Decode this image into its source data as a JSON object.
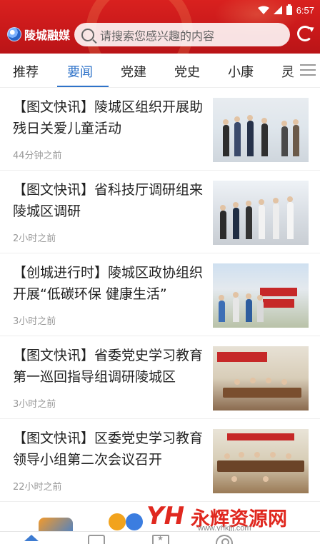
{
  "status_bar": {
    "time": "6:57"
  },
  "header": {
    "app_name": "陵城融媒",
    "search_placeholder": "请搜索您感兴趣的内容"
  },
  "tabs": [
    "推荐",
    "要闻",
    "党建",
    "党史",
    "小康",
    "灵"
  ],
  "active_tab": "要闻",
  "news": [
    {
      "title": "【图文快讯】陵城区组织开展助残日关爱儿童活动",
      "time": "44分钟之前"
    },
    {
      "title": "【图文快讯】省科技厅调研组来陵城区调研",
      "time": "2小时之前"
    },
    {
      "title": "【创城进行时】陵城区政协组织开展“低碳环保 健康生活”",
      "time": "3小时之前"
    },
    {
      "title": "【图文快讯】省委党史学习教育第一巡回指导组调研陵城区",
      "time": "3小时之前"
    },
    {
      "title": "【图文快讯】区委党史学习教育领导小组第二次会议召开",
      "time": "22小时之前"
    }
  ],
  "watermark": {
    "logo": "YH",
    "text": "永辉资源网",
    "url": "www.yhkjjj.com"
  },
  "colors": {
    "header_red": "#d9211f",
    "accent_blue": "#2f73c9",
    "watermark_red": "#e0281f"
  },
  "icons": [
    "search-icon",
    "refresh-icon",
    "menu-icon",
    "home-icon",
    "box-icon",
    "star-icon",
    "user-icon"
  ]
}
